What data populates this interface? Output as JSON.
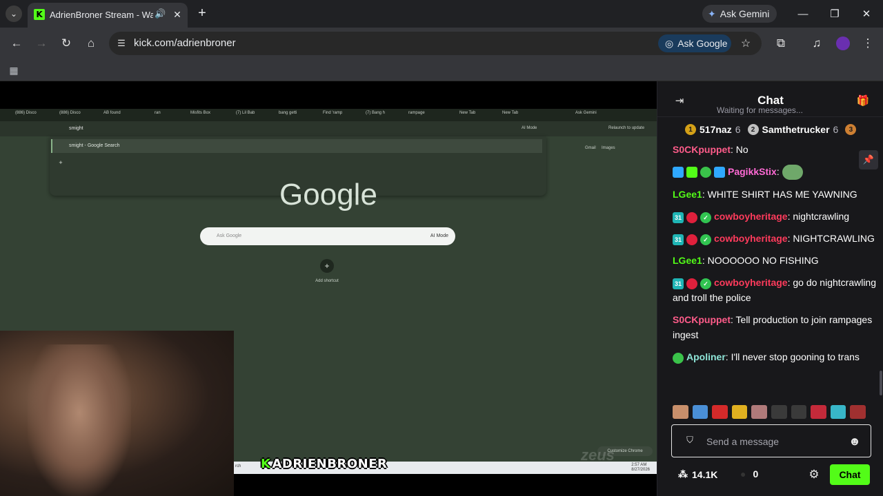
{
  "browser": {
    "tab_title": "AdrienBroner Stream - Watch",
    "url": "kick.com/adrienbroner",
    "ask_gemini": "Ask Gemini",
    "ask_google": "Ask Google"
  },
  "shared_screen": {
    "tabs": [
      "(886) Disco",
      "(886) Disco",
      "AB found",
      "ran",
      "Misfits Box",
      "(7) Lil Bab",
      "bang getti",
      "Find 'ramp",
      "(7) Bang h",
      "rampage",
      "New Tab",
      "New Tab"
    ],
    "ask_gemini": "Ask Gemini",
    "omnibox_value": "smight",
    "ai_mode": "AI Mode",
    "relaunch": "Relaunch to update",
    "suggestion": "smight - Google Search",
    "gmail": "Gmail",
    "images": "Images",
    "google_logo": "Google",
    "search_placeholder": "Ask Google",
    "search_ai_mode": "AI Mode",
    "add_shortcut": "Add shortcut",
    "customize": "Customize Chrome",
    "taskbar_search": "rch",
    "taskbar_time": "2:57 AM",
    "taskbar_date": "8/27/2026"
  },
  "stream": {
    "banner_name": "ADRIENBRONER",
    "watermark": "zeus"
  },
  "chat": {
    "title": "Chat",
    "status": "Waiting for messages...",
    "leaderboard": [
      {
        "rank": "1",
        "name": "517naz",
        "count": "6",
        "color": "#d4a017"
      },
      {
        "rank": "2",
        "name": "Samthetrucker",
        "count": "6",
        "color": "#c0c0c0"
      },
      {
        "rank": "3",
        "name": "",
        "count": "",
        "color": "#cd7f32"
      }
    ],
    "messages": [
      {
        "user": "S0CKpuppet",
        "color": "#ff5c8a",
        "text": "No",
        "badges": []
      },
      {
        "user": "PagikkStix",
        "color": "#ff6ad5",
        "text": "",
        "badges": [
          "#2fa8ff",
          "#53fc18",
          "#3ac24a",
          "#2fa8ff"
        ],
        "emote": true
      },
      {
        "user": "LGee1",
        "color": "#53fc18",
        "text": "WHITE SHIRT HAS ME YAWNING",
        "badges": []
      },
      {
        "user": "cowboyheritage",
        "color": "#ff3b5c",
        "text": "nightcrawling",
        "badges": [
          "#1fb5b5",
          "#e0203c",
          "#31c451"
        ]
      },
      {
        "user": "cowboyheritage",
        "color": "#ff3b5c",
        "text": "NIGHTCRAWLING",
        "badges": [
          "#1fb5b5",
          "#e0203c",
          "#31c451"
        ]
      },
      {
        "user": "LGee1",
        "color": "#53fc18",
        "text": "NOOOOOO NO FISHING",
        "badges": []
      },
      {
        "user": "cowboyheritage",
        "color": "#ff3b5c",
        "text": "go do nightcrawling and troll the police",
        "badges": [
          "#1fb5b5",
          "#e0203c",
          "#31c451"
        ]
      },
      {
        "user": "S0CKpuppet",
        "color": "#ff5c8a",
        "text": "Tell production to join rampages ingest",
        "badges": []
      },
      {
        "user": "Apoliner",
        "color": "#8fe6d9",
        "text": "I'll never stop gooning to trans",
        "badges": [
          "#3ac24a"
        ]
      }
    ],
    "badge_sub_label": "31",
    "input_placeholder": "Send a message",
    "viewers": "14.1K",
    "points": "0",
    "chat_button": "Chat",
    "accent": "#53fc18"
  }
}
